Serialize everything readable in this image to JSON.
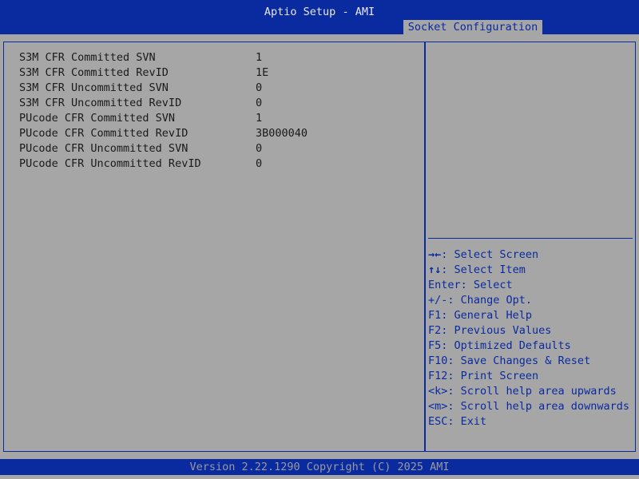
{
  "header": {
    "title": "Aptio Setup - AMI",
    "active_tab": "Socket Configuration"
  },
  "settings": [
    {
      "label": "S3M CFR Committed SVN",
      "value": "1"
    },
    {
      "label": "S3M CFR Committed RevID",
      "value": "1E"
    },
    {
      "label": "S3M CFR Uncommitted SVN",
      "value": "0"
    },
    {
      "label": "S3M CFR Uncommitted RevID",
      "value": "0"
    },
    {
      "label": "PUcode CFR Committed SVN",
      "value": "1"
    },
    {
      "label": "PUcode CFR Committed RevID",
      "value": "3B000040"
    },
    {
      "label": "PUcode CFR Uncommitted SVN",
      "value": "0"
    },
    {
      "label": "PUcode CFR Uncommitted RevID",
      "value": "0"
    }
  ],
  "help": [
    {
      "key": "→←",
      "text": ": Select Screen"
    },
    {
      "key": "↑↓",
      "text": ": Select Item"
    },
    {
      "key": "",
      "text": "Enter: Select"
    },
    {
      "key": "",
      "text": "+/-: Change Opt."
    },
    {
      "key": "",
      "text": "F1: General Help"
    },
    {
      "key": "",
      "text": "F2: Previous Values"
    },
    {
      "key": "",
      "text": "F5: Optimized Defaults"
    },
    {
      "key": "",
      "text": "F10: Save Changes & Reset"
    },
    {
      "key": "",
      "text": "F12: Print Screen"
    },
    {
      "key": "",
      "text": "<k>: Scroll help area upwards"
    },
    {
      "key": "",
      "text": "<m>: Scroll help area downwards"
    },
    {
      "key": "",
      "text": "ESC: Exit"
    }
  ],
  "footer": {
    "text": "Version 2.22.1290 Copyright (C) 2025 AMI"
  }
}
